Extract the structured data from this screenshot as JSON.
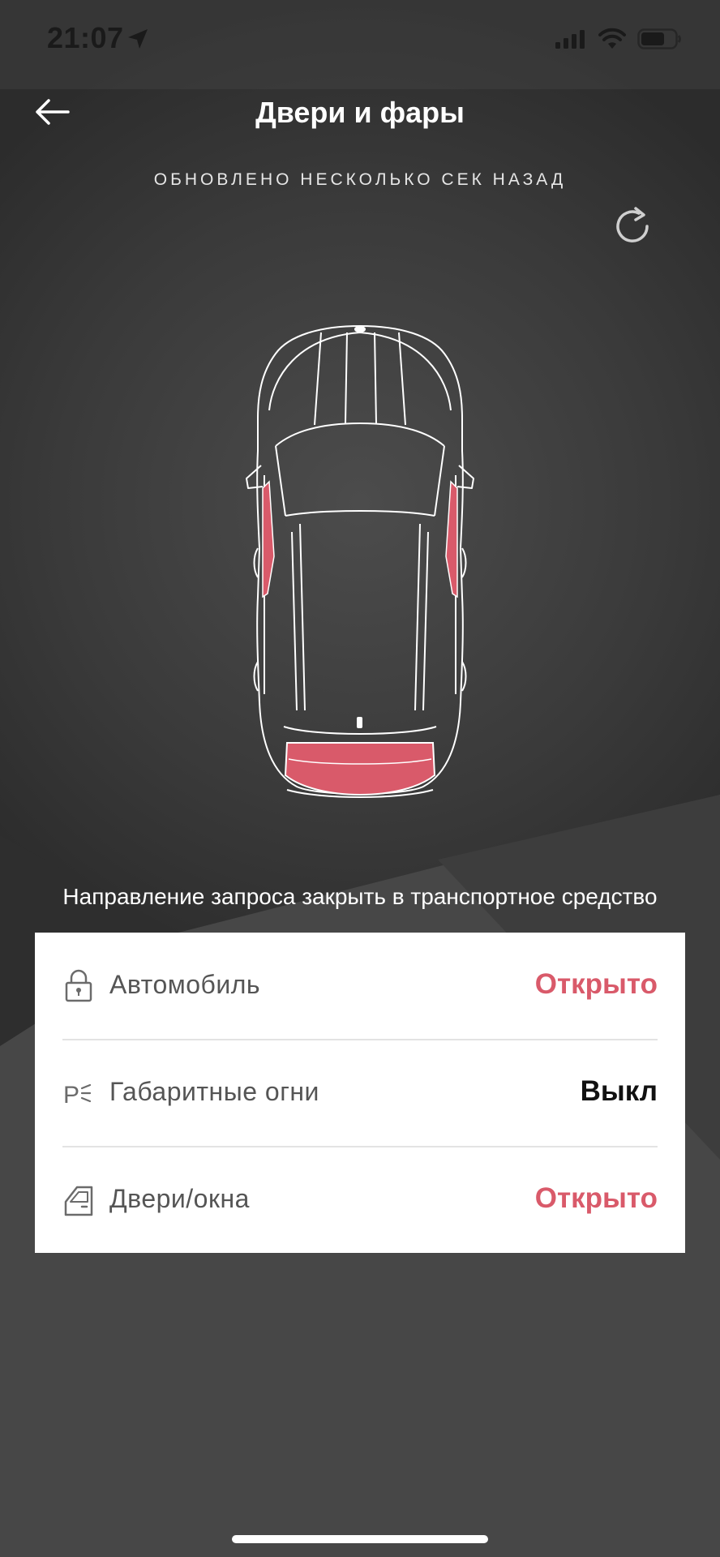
{
  "status_bar": {
    "time": "21:07"
  },
  "header": {
    "title": "Двери и фары",
    "updated": "ОБНОВЛЕНО НЕСКОЛЬКО СЕК НАЗАД"
  },
  "icons": {
    "back": "arrow-left-icon",
    "refresh": "refresh-icon",
    "location": "location-arrow-icon",
    "cellular": "cellular-signal-icon",
    "wifi": "wifi-icon",
    "battery": "battery-icon"
  },
  "car": {
    "open_parts": [
      "front-left-door",
      "front-right-door",
      "trunk"
    ],
    "highlight_color": "#d95a6a"
  },
  "request_text": "Направление запроса закрыть в транспортное средство",
  "status_rows": [
    {
      "icon": "lock-icon",
      "label": "Автомобиль",
      "value": "Открыто",
      "value_color": "#d95a6a"
    },
    {
      "icon": "parking-lights-icon",
      "label": "Габаритные огни",
      "value": "Выкл",
      "value_color": "#111111"
    },
    {
      "icon": "car-door-icon",
      "label": "Двери/окна",
      "value": "Открыто",
      "value_color": "#d95a6a"
    }
  ],
  "colors": {
    "accent_open": "#d95a6a",
    "card_bg": "#ffffff",
    "screen_bg": "#4a4a4a"
  }
}
